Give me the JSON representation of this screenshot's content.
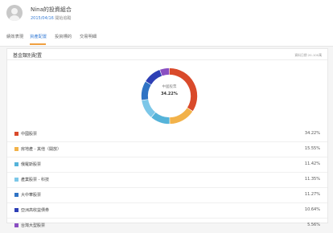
{
  "header": {
    "title": "Nina的投資組合",
    "date": "2015/04/16",
    "date_suffix": "開始追蹤"
  },
  "tabs": [
    {
      "label": "績效表現"
    },
    {
      "label": "資產配置",
      "active": true
    },
    {
      "label": "投資標的"
    },
    {
      "label": "交易明細"
    }
  ],
  "allocation": {
    "title": "基金類別配置",
    "note": "資料日期 20-100萬",
    "center_label": "中國股票",
    "center_value": "34.22%",
    "items": [
      {
        "name": "中國股票",
        "percent": "34.22%",
        "value": 34.22,
        "color": "#d94a2b"
      },
      {
        "name": "房地產 - 其他（開放）",
        "percent": "15.55%",
        "value": 15.55,
        "color": "#f2b24a"
      },
      {
        "name": "俄羅斯股票",
        "percent": "11.42%",
        "value": 11.42,
        "color": "#55b3d9"
      },
      {
        "name": "產業股票 - 科技",
        "percent": "11.35%",
        "value": 11.35,
        "color": "#7cc7e8"
      },
      {
        "name": "大中華股票",
        "percent": "11.27%",
        "value": 11.27,
        "color": "#2f73c4"
      },
      {
        "name": "亞洲高收益債券",
        "percent": "10.64%",
        "value": 10.64,
        "color": "#2d3fb5"
      },
      {
        "name": "台灣大型股票",
        "percent": "5.56%",
        "value": 5.56,
        "color": "#8a4fc2"
      }
    ]
  }
}
